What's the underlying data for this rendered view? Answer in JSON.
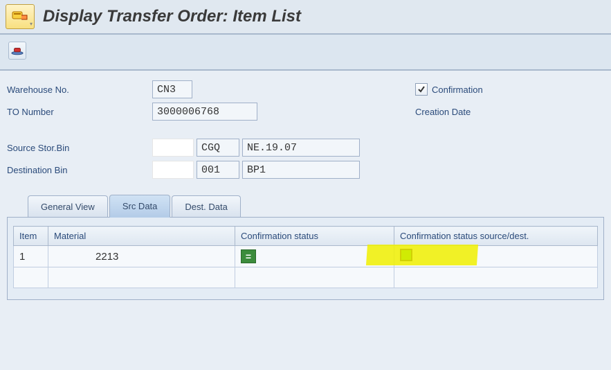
{
  "title": "Display Transfer Order: Item List",
  "form": {
    "warehouse_label": "Warehouse No.",
    "warehouse_value": "CN3",
    "to_label": "TO Number",
    "to_value": "3000006768",
    "confirmation_label": "Confirmation",
    "creation_date_label": "Creation Date",
    "src_bin_label": "Source Stor.Bin",
    "src_bin_type": "CGQ",
    "src_bin_value": "NE.19.07",
    "dest_bin_label": "Destination Bin",
    "dest_bin_type": "001",
    "dest_bin_value": "BP1"
  },
  "tabs": {
    "general": "General View",
    "src": "Src Data",
    "dest": "Dest. Data"
  },
  "table": {
    "col_item": "Item",
    "col_material": "Material",
    "col_conf": "Confirmation status",
    "col_conf_sd": "Confirmation status source/dest.",
    "rows": [
      {
        "item": "1",
        "material_tail": "2213",
        "status_glyph": "="
      }
    ]
  }
}
